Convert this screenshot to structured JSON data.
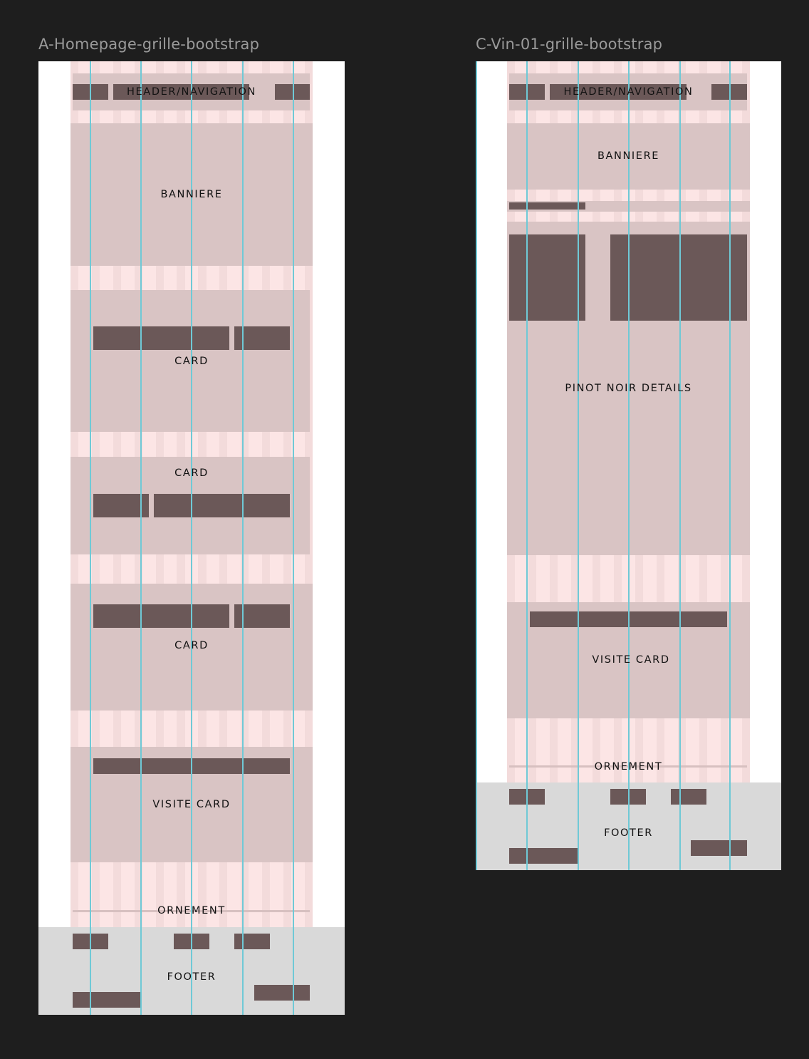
{
  "frames": [
    {
      "title": "A-Homepage-grille-bootstrap",
      "labels": {
        "header": "HEADER/NAVIGATION",
        "banner": "BANNIERE",
        "card1": "CARD",
        "card2": "CARD",
        "card3": "CARD",
        "visit": "VISITE CARD",
        "ornament": "ORNEMENT",
        "footer": "FOOTER"
      }
    },
    {
      "title": "C-Vin-01-grille-bootstrap",
      "labels": {
        "header": "HEADER/NAVIGATION",
        "banner": "BANNIERE",
        "details": "PINOT NOIR DETAILS",
        "visit": "VISITE CARD",
        "ornament": "ORNEMENT",
        "footer": "FOOTER"
      }
    }
  ],
  "colors": {
    "canvas": "#1e1e1e",
    "frame": "#ffffff",
    "grid_gutter": "#fce5e5",
    "section_block": "#d9c4c4",
    "content_bar": "#6b5858",
    "guide_line": "#6fc9d6",
    "footer_bg": "#d9d9d9"
  }
}
